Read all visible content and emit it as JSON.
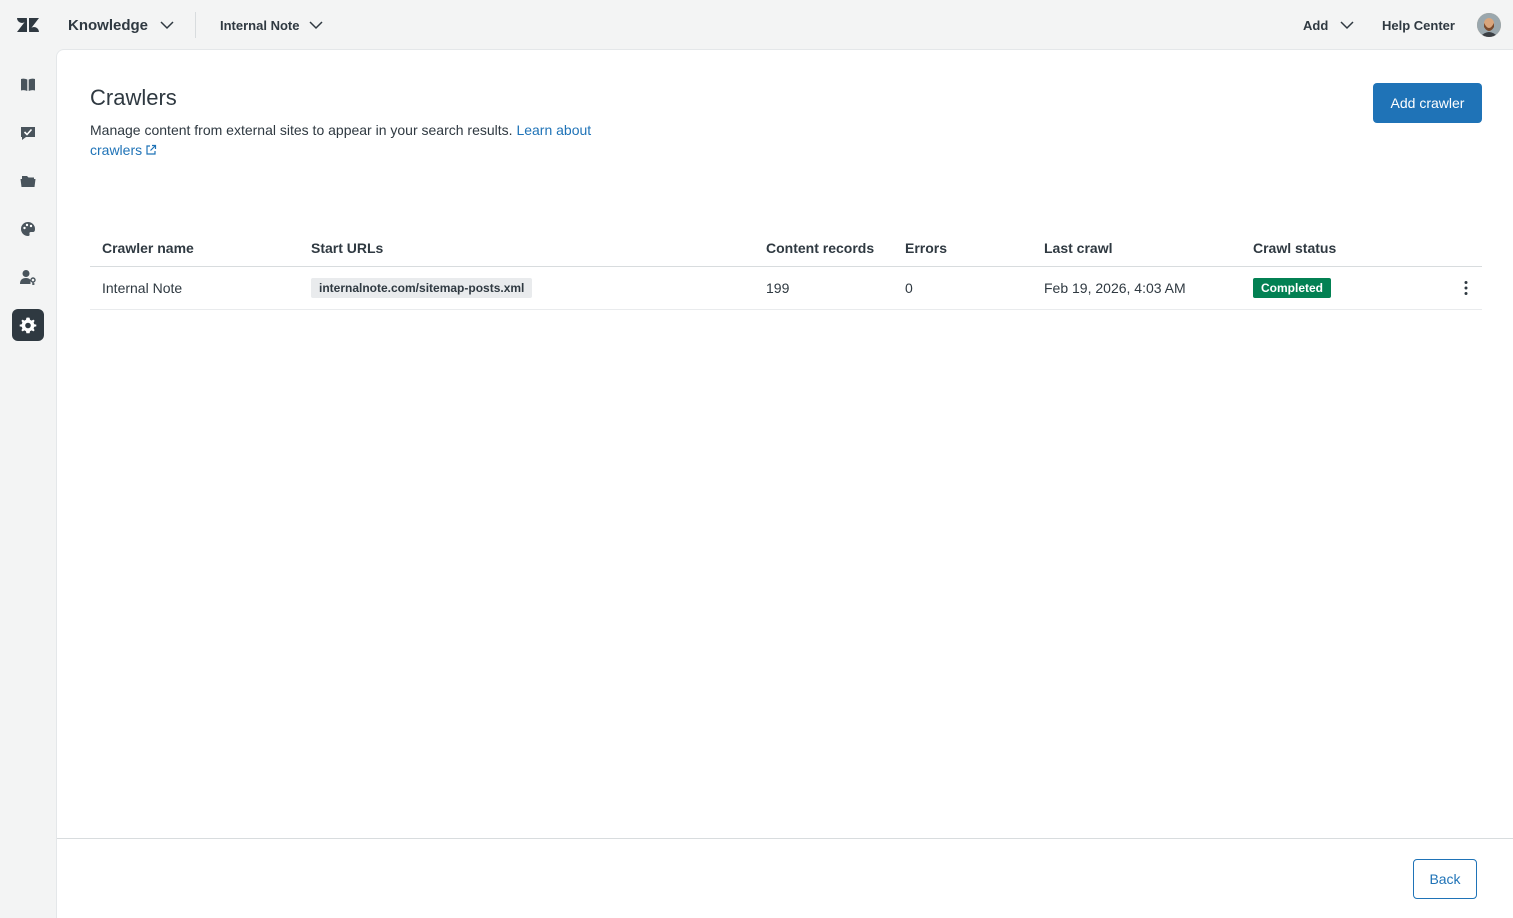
{
  "topbar": {
    "product": "Knowledge",
    "brand": "Internal Note",
    "add_label": "Add",
    "help_center_label": "Help Center"
  },
  "sidebar": {
    "items": [
      {
        "name": "knowledge-icon",
        "active": false
      },
      {
        "name": "review-icon",
        "active": false
      },
      {
        "name": "folders-icon",
        "active": false
      },
      {
        "name": "palette-icon",
        "active": false
      },
      {
        "name": "user-permissions-icon",
        "active": false
      },
      {
        "name": "settings-gear-icon",
        "active": true
      }
    ]
  },
  "page": {
    "title": "Crawlers",
    "description": "Manage content from external sites to appear in your search results.",
    "learn_link": "Learn about",
    "learn_link_2": "crawlers",
    "add_button": "Add crawler"
  },
  "table": {
    "headers": {
      "name": "Crawler name",
      "urls": "Start URLs",
      "records": "Content records",
      "errors": "Errors",
      "last_crawl": "Last crawl",
      "status": "Crawl status"
    },
    "rows": [
      {
        "name": "Internal Note",
        "url": "internalnote.com/sitemap-posts.xml",
        "records": "199",
        "errors": "0",
        "last_crawl": "Feb 19, 2026, 4:03 AM",
        "status": "Completed"
      }
    ]
  },
  "footer": {
    "back_label": "Back"
  },
  "colors": {
    "accent": "#1f73b7",
    "status_success": "#038153",
    "text": "#2f3941"
  }
}
